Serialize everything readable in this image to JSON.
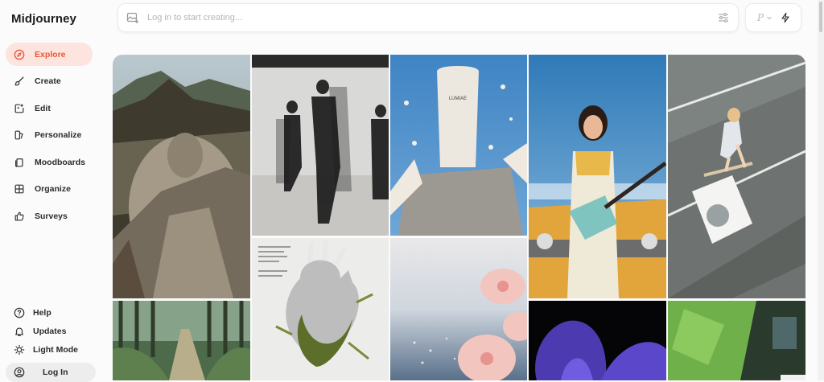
{
  "app": {
    "title": "Midjourney"
  },
  "sidebar": {
    "items": [
      {
        "label": "Explore",
        "icon": "compass-icon",
        "active": true
      },
      {
        "label": "Create",
        "icon": "brush-icon"
      },
      {
        "label": "Edit",
        "icon": "edit-image-icon"
      },
      {
        "label": "Personalize",
        "icon": "personalize-icon"
      },
      {
        "label": "Moodboards",
        "icon": "moodboard-icon"
      },
      {
        "label": "Organize",
        "icon": "grid-icon"
      },
      {
        "label": "Surveys",
        "icon": "thumbs-up-icon"
      }
    ],
    "bottom": [
      {
        "label": "Help",
        "icon": "help-icon"
      },
      {
        "label": "Updates",
        "icon": "bell-icon"
      },
      {
        "label": "Light Mode",
        "icon": "sun-icon"
      }
    ],
    "login": {
      "label": "Log In",
      "icon": "user-icon"
    }
  },
  "prompt": {
    "placeholder": "Log in to start creating..."
  },
  "mode": {
    "personalize_letter": "P"
  },
  "colors": {
    "accent": "#e8583a",
    "active_bg": "#fde4de"
  },
  "gallery": {
    "images": [
      "christ-statue-selfie",
      "walking-figures-motion-blur",
      "skincare-tube-product-shot",
      "woman-guitar-yellow-car",
      "girl-skateboard-washing-machine",
      "forest-path",
      "anatomical-heart-moss",
      "pink-flowers-sea",
      "purple-iris",
      "green-window-blur"
    ],
    "product_label": "LUMIAE"
  }
}
